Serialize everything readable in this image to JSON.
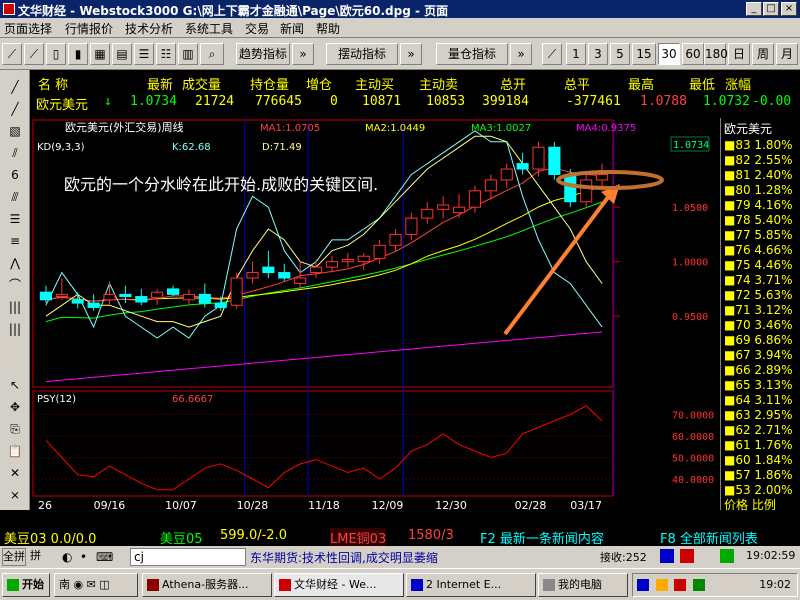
{
  "window": {
    "title": "文华财经 - Webstock3000   G:\\网上下霸才金融通\\Page\\欧元60.dpg - 页面"
  },
  "menu": [
    "页面选择",
    "行情报价",
    "技术分析",
    "系统工具",
    "交易",
    "新闻",
    "帮助"
  ],
  "toolbar": {
    "trend_label": "趋势指标",
    "swing_label": "摆动指标",
    "volume_label": "量仓指标",
    "periods": [
      "1",
      "3",
      "5",
      "15",
      "30",
      "60",
      "180",
      "日",
      "周",
      "月"
    ],
    "active_period": "30"
  },
  "quote": {
    "headers": [
      "名  称",
      "最新",
      "成交量",
      "持仓量",
      "增仓",
      "主动买",
      "主动卖",
      "总开",
      "总平",
      "最高",
      "最低",
      "涨幅"
    ],
    "name": "欧元美元",
    "values": [
      "1.0734",
      "21724",
      "776645",
      "0",
      "10871",
      "10853",
      "399184",
      "-377461",
      "1.0788",
      "1.0732",
      "-0.00"
    ]
  },
  "chart_data": {
    "type": "candlestick",
    "title": "欧元美元(外汇交易)周线",
    "ma": [
      {
        "name": "MA1",
        "value": "1.0705",
        "color": "#ff4040"
      },
      {
        "name": "MA2",
        "value": "1.0449",
        "color": "#ffff00"
      },
      {
        "name": "MA3",
        "value": "1.0027",
        "color": "#00ff00"
      },
      {
        "name": "MA4",
        "value": "0.9375",
        "color": "#ff00ff"
      }
    ],
    "kd": {
      "label": "KD(9,3,3)",
      "k": "K:62.68",
      "d": "D:71.49"
    },
    "annotation": "欧元的一个分水岭在此开始.成败的关键区间.",
    "current_price": "1.0734",
    "y_ticks": [
      "1.0500",
      "1.0000",
      "0.9500"
    ],
    "y_values": [
      1.05,
      1.0,
      0.95
    ],
    "ylim": [
      0.885,
      1.13
    ],
    "candles": [
      [
        0.972,
        0.978,
        0.962,
        0.965
      ],
      [
        0.968,
        0.985,
        0.965,
        0.97
      ],
      [
        0.965,
        0.972,
        0.957,
        0.962
      ],
      [
        0.962,
        0.97,
        0.955,
        0.958
      ],
      [
        0.965,
        0.982,
        0.96,
        0.97
      ],
      [
        0.97,
        0.978,
        0.962,
        0.968
      ],
      [
        0.968,
        0.975,
        0.96,
        0.963
      ],
      [
        0.967,
        0.975,
        0.96,
        0.972
      ],
      [
        0.975,
        0.978,
        0.968,
        0.97
      ],
      [
        0.965,
        0.975,
        0.96,
        0.97
      ],
      [
        0.97,
        0.98,
        0.958,
        0.962
      ],
      [
        0.962,
        0.968,
        0.955,
        0.958
      ],
      [
        0.96,
        0.99,
        0.957,
        0.985
      ],
      [
        0.985,
        1.0,
        0.98,
        0.99
      ],
      [
        0.995,
        1.01,
        0.985,
        0.99
      ],
      [
        0.99,
        0.998,
        0.982,
        0.985
      ],
      [
        0.98,
        1.0,
        0.975,
        0.985
      ],
      [
        0.99,
        1.002,
        0.985,
        0.995
      ],
      [
        0.995,
        1.005,
        0.99,
        1.0
      ],
      [
        1.0,
        1.008,
        0.995,
        1.002
      ],
      [
        1.0,
        1.008,
        0.992,
        1.005
      ],
      [
        1.003,
        1.02,
        0.998,
        1.015
      ],
      [
        1.015,
        1.03,
        1.01,
        1.025
      ],
      [
        1.025,
        1.045,
        1.02,
        1.04
      ],
      [
        1.04,
        1.055,
        1.035,
        1.048
      ],
      [
        1.048,
        1.06,
        1.04,
        1.052
      ],
      [
        1.045,
        1.062,
        1.04,
        1.05
      ],
      [
        1.05,
        1.07,
        1.045,
        1.065
      ],
      [
        1.065,
        1.08,
        1.058,
        1.075
      ],
      [
        1.075,
        1.09,
        1.068,
        1.085
      ],
      [
        1.09,
        1.1,
        1.08,
        1.085
      ],
      [
        1.085,
        1.11,
        1.078,
        1.105
      ],
      [
        1.105,
        1.11,
        1.075,
        1.08
      ],
      [
        1.08,
        1.085,
        1.05,
        1.055
      ],
      [
        1.055,
        1.08,
        1.05,
        1.075
      ],
      [
        1.075,
        1.09,
        1.065,
        1.08
      ]
    ],
    "psy": {
      "label": "PSY(12)",
      "value": "66.6667",
      "y_ticks": [
        "70.0000",
        "60.0000",
        "50.0000",
        "40.0000"
      ],
      "y_values": [
        70,
        60,
        50,
        40
      ],
      "ylim": [
        33,
        80
      ],
      "values": [
        58,
        50,
        42,
        41,
        46,
        42,
        38,
        35,
        35,
        40,
        45,
        47,
        44,
        40,
        36,
        43,
        47,
        49,
        46,
        43,
        45,
        40,
        45,
        53,
        56,
        61,
        56,
        53,
        50,
        52,
        61,
        64,
        67,
        70,
        74,
        67
      ]
    },
    "x_labels": [
      "26",
      "09/16",
      "10/07",
      "10/28",
      "11/18",
      "12/09",
      "12/30",
      "02/28",
      "03/17"
    ]
  },
  "right_panel": {
    "title": "欧元美元",
    "rows": [
      "83 1.80%",
      "82 2.55%",
      "81 2.40%",
      "80 1.28%",
      "79 4.16%",
      "78 5.40%",
      "77 5.85%",
      "76 4.66%",
      "75 4.46%",
      "74 3.71%",
      "72 5.63%",
      "71 3.12%",
      "70 3.46%",
      "69 6.86%",
      "67 3.94%",
      "66 2.89%",
      "65 3.13%",
      "64 3.11%",
      "63 2.95%",
      "62 2.71%",
      "61 1.76%",
      "60 1.84%",
      "57 1.86%",
      "53 2.00%"
    ],
    "footer": "价格 比例"
  },
  "status": {
    "soybean": "美豆03    0.0/0.0",
    "soybean05": "美豆05",
    "soybean05_val": "599.0/-2.0",
    "lme": "LME铜03",
    "lme_val": "1580/3",
    "f2": "F2 最新一条新闻内容",
    "f8": "F8 全部新闻列表"
  },
  "input": {
    "btn_full": "全拼",
    "value": "cj",
    "news": "东华期货:技术性回调,成交明显萎缩",
    "recv": "接收:252",
    "time": "19:02:59"
  },
  "taskbar": {
    "start": "开始",
    "tasks": [
      "Athena-服务器...",
      "文华财经 - We...",
      "2 Internet E...",
      "我的电脑"
    ],
    "clock": "19:02"
  }
}
